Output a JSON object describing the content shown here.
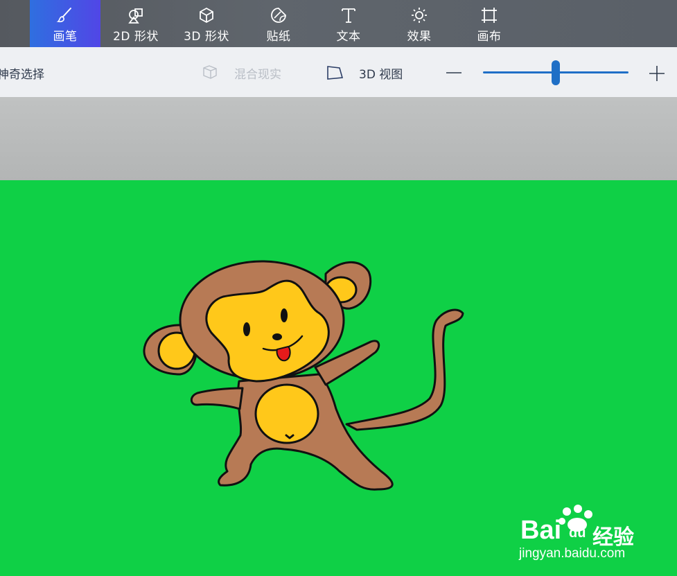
{
  "toolbar": {
    "tools": [
      {
        "label": "画笔",
        "icon": "brush-icon"
      },
      {
        "label": "2D 形状",
        "icon": "2d-shapes-icon"
      },
      {
        "label": "3D 形状",
        "icon": "3d-shapes-icon"
      },
      {
        "label": "贴纸",
        "icon": "stickers-icon"
      },
      {
        "label": "文本",
        "icon": "text-icon"
      },
      {
        "label": "效果",
        "icon": "effects-icon"
      },
      {
        "label": "画布",
        "icon": "canvas-icon"
      }
    ],
    "active_index": 0,
    "active_color": "#3f5ee6"
  },
  "subbar": {
    "magic_select_label": "神奇选择",
    "mixed_reality_label": "混合现实",
    "view3d_label": "3D 视图",
    "zoom_minus": "—",
    "zoom_plus": "+",
    "accent_color": "#1f6fc6"
  },
  "canvas": {
    "background_color": "#0fd046",
    "content": "monkey-drawing"
  },
  "watermark": {
    "brand_a": "Bai",
    "brand_b": "du",
    "brand_cn": "经验",
    "url": "jingyan.baidu.com"
  }
}
